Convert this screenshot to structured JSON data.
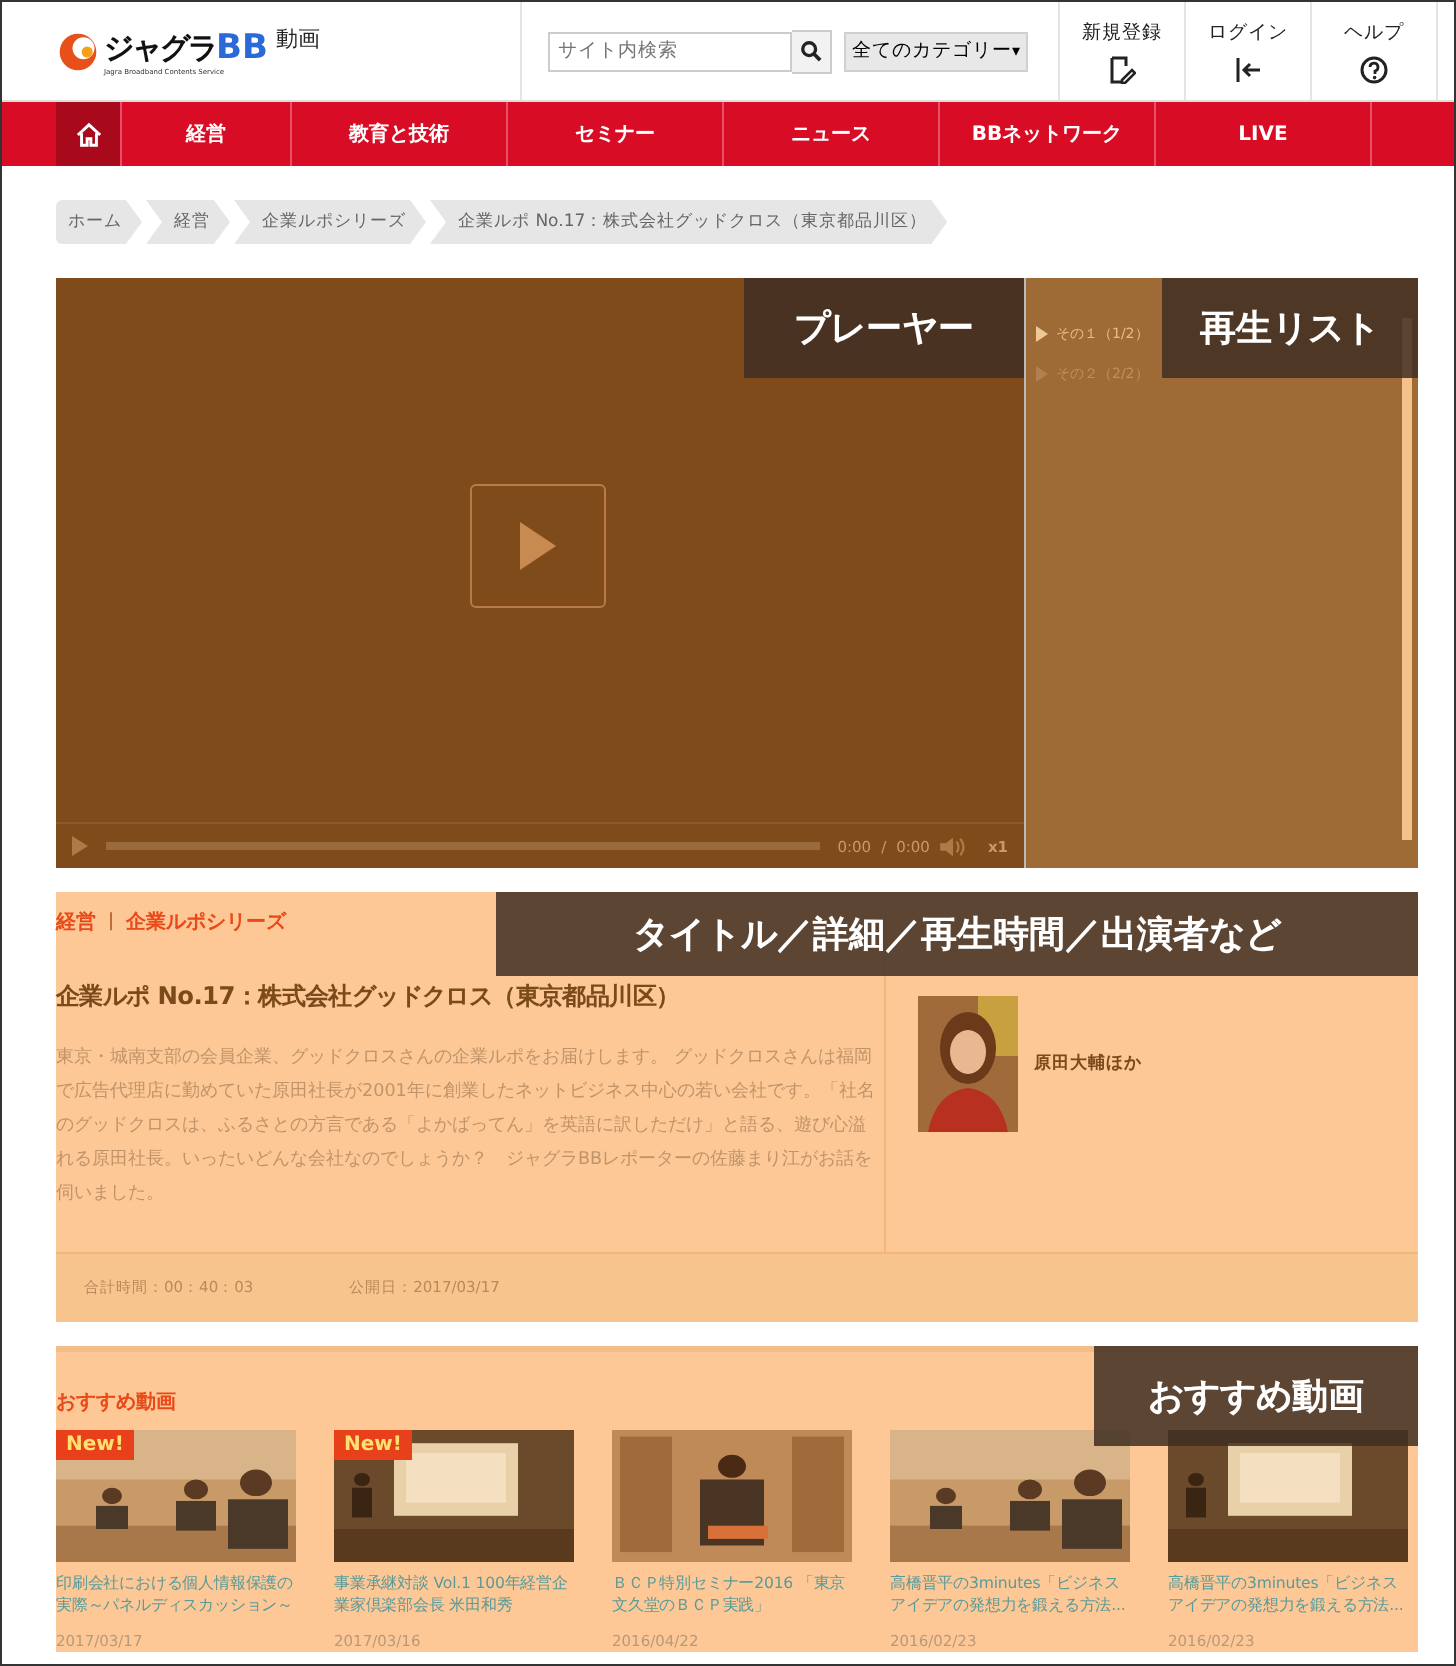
{
  "header": {
    "logo": {
      "brand": "ジャグラ",
      "brand_suffix": "BB",
      "tagline": "Jagra Broadband Contents Service",
      "section": "動画"
    },
    "search": {
      "placeholder": "サイト内検索"
    },
    "category": {
      "label": "全てのカテゴリー",
      "caret": "▾"
    },
    "links": [
      {
        "kind": "register",
        "label": "新規登録"
      },
      {
        "kind": "login",
        "label": "ログイン"
      },
      {
        "kind": "help",
        "label": "ヘルプ"
      }
    ]
  },
  "nav": {
    "items": [
      {
        "kind": "home",
        "selected": true
      },
      {
        "kind": "text",
        "label": "経営",
        "selected": false
      },
      {
        "kind": "text",
        "label": "教育と技術",
        "selected": false
      },
      {
        "kind": "text",
        "label": "セミナー",
        "selected": false
      },
      {
        "kind": "text",
        "label": "ニュース",
        "selected": false
      },
      {
        "kind": "text",
        "label": "BBネットワーク",
        "selected": false
      },
      {
        "kind": "text",
        "label": "LIVE",
        "selected": false
      }
    ]
  },
  "breadcrumb": [
    "ホーム",
    "経営",
    "企業ルポシリーズ",
    "企業ルポ No.17：株式会社グッドクロス（東京都品川区）"
  ],
  "player": {
    "time_current": "0:00",
    "time_separator": "/",
    "time_total": "0:00",
    "speed": "x1"
  },
  "playlist": {
    "items": [
      {
        "label": "その１（1/2）",
        "selected": true
      },
      {
        "label": "その２（2/2）",
        "selected": false
      }
    ]
  },
  "info": {
    "categories": [
      "経営",
      "企業ルポシリーズ"
    ],
    "separator": "|",
    "title": "企業ルポ No.17：株式会社グッドクロス（東京都品川区）",
    "description": "東京・城南支部の会員企業、グッドクロスさんの企業ルポをお届けします。 グッドクロスさんは福岡で広告代理店に勤めていた原田社長が2001年に創業したネットビジネス中心の若い会社です。「社名のグッドクロスは、ふるさとの方言である「よかばってん」を英語に訳しただけ」と語る、遊び心溢れる原田社長。いったいどんな会社なのでしょうか？　ジャグラBBレポーターの佐藤まり江がお話を伺いました。",
    "performer": "原田大輔ほか",
    "total_time": "合計時間：00：40：03",
    "published": "公開日：2017/03/17"
  },
  "recommended": {
    "heading": "おすすめ動画",
    "items": [
      {
        "new": true,
        "badge": "New!",
        "title": "印刷会社における個人情報保護の実際～パネルディスカッション～",
        "date": "2017/03/17"
      },
      {
        "new": true,
        "badge": "New!",
        "title": "事業承継対談 Vol.1 100年経営企業家倶楽部会長 米田和秀",
        "date": "2017/03/16"
      },
      {
        "new": false,
        "title": "ＢＣＰ特別セミナー2016 「東京文久堂のＢＣＰ実践」",
        "date": "2016/04/22"
      },
      {
        "new": false,
        "title": "高橋晋平の3minutes「ビジネスアイデアの発想力を鍛える方法...",
        "date": "2016/02/23"
      },
      {
        "new": false,
        "title": "高橋晋平の3minutes「ビジネスアイデアの発想力を鍛える方法...",
        "date": "2016/02/23"
      }
    ]
  },
  "annotations": {
    "player": "プレーヤー",
    "playlist": "再生リスト",
    "info": "タイトル／詳細／再生時間／出演者など",
    "recommended": "おすすめ動画"
  }
}
